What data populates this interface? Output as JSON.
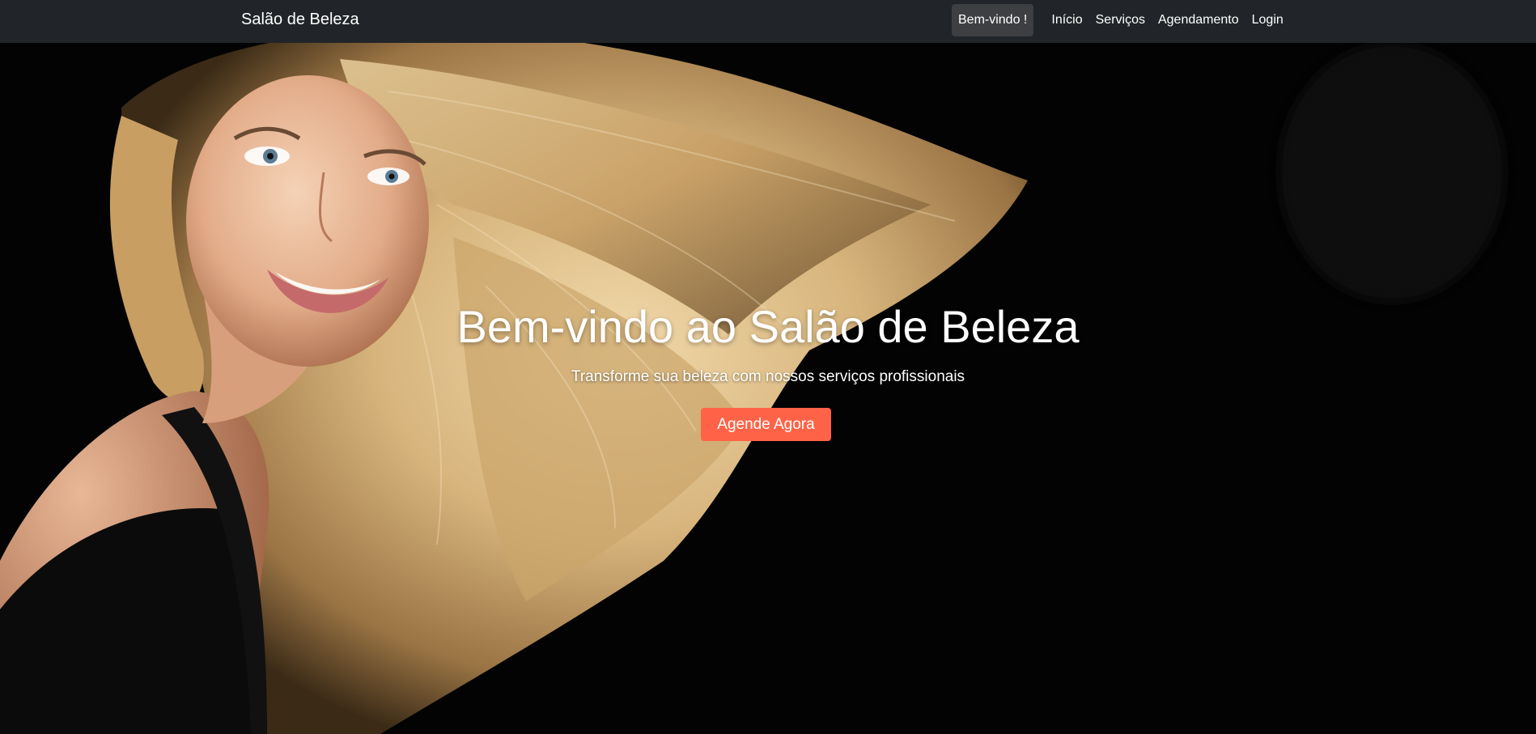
{
  "navbar": {
    "brand": "Salão de Beleza",
    "welcome": "Bem-vindo !",
    "links": [
      "Início",
      "Serviços",
      "Agendamento",
      "Login"
    ]
  },
  "hero": {
    "title": "Bem-vindo ao Salão de Beleza",
    "subtitle": "Transforme sua beleza com nossos serviços profissionais",
    "cta_label": "Agende Agora"
  },
  "colors": {
    "navbar_bg": "#212529",
    "cta_bg": "#ff6347",
    "hero_bg": "#030303"
  }
}
